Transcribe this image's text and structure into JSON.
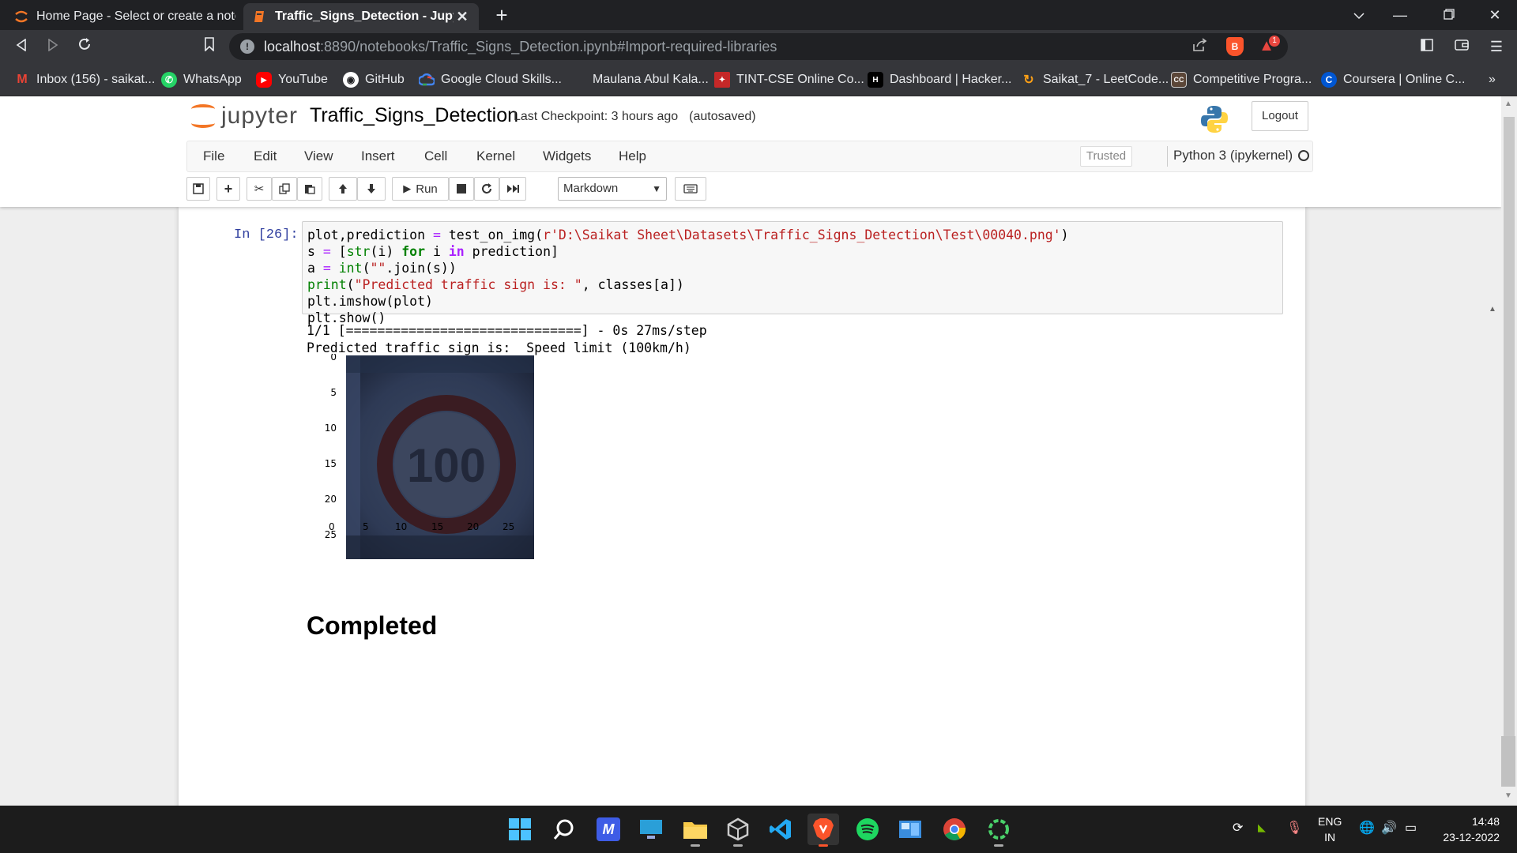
{
  "browser": {
    "tabs": [
      {
        "title": "Home Page - Select or create a notebook",
        "active": false
      },
      {
        "title": "Traffic_Signs_Detection - Jupyter Notebook",
        "active": true
      }
    ],
    "url_host": "localhost",
    "url_rest": ":8890/notebooks/Traffic_Signs_Detection.ipynb#Import-required-libraries",
    "brave_badge": "1",
    "bookmarks": [
      {
        "label": "Inbox (156) - saikat...",
        "icon": "gmail-icon",
        "color": "#ea4335"
      },
      {
        "label": "WhatsApp",
        "icon": "whatsapp-icon",
        "color": "#25d366"
      },
      {
        "label": "YouTube",
        "icon": "youtube-icon",
        "color": "#ff0000"
      },
      {
        "label": "GitHub",
        "icon": "github-icon",
        "color": "#ffffff"
      },
      {
        "label": "Google Cloud Skills...",
        "icon": "google-cloud-icon",
        "color": "#4285f4"
      },
      {
        "label": "Maulana Abul Kala...",
        "icon": "university-icon",
        "color": "#35363a"
      },
      {
        "label": "TINT-CSE Online Co...",
        "icon": "tint-icon",
        "color": "#c62828"
      },
      {
        "label": "Dashboard | Hacker...",
        "icon": "hackerrank-icon",
        "color": "#1ba94c"
      },
      {
        "label": "Saikat_7 - LeetCode...",
        "icon": "leetcode-icon",
        "color": "#ffa116"
      },
      {
        "label": "Competitive Progra...",
        "icon": "codechef-icon",
        "color": "#5b4638"
      },
      {
        "label": "Coursera | Online C...",
        "icon": "coursera-icon",
        "color": "#0056d2"
      }
    ]
  },
  "jupyter": {
    "logo_text": "jupyter",
    "notebook_name": "Traffic_Signs_Detection",
    "checkpoint": "Last Checkpoint: 3 hours ago",
    "autosaved": "(autosaved)",
    "logout_label": "Logout",
    "menus": [
      "File",
      "Edit",
      "View",
      "Insert",
      "Cell",
      "Kernel",
      "Widgets",
      "Help"
    ],
    "trusted_label": "Trusted",
    "kernel_label": "Python 3 (ipykernel)",
    "run_label": "Run",
    "cell_type": "Markdown"
  },
  "cell": {
    "prompt": "In [26]:",
    "code": {
      "l1_a": "plot,prediction ",
      "l1_eq": "=",
      "l1_b": " test_on_img(",
      "l1_str": "r'D:\\Saikat Sheet\\Datasets\\Traffic_Signs_Detection\\Test\\00040.png'",
      "l1_c": ")",
      "l2_a": "s ",
      "l2_eq": "=",
      "l2_b": " [",
      "l2_str": "str",
      "l2_c": "(i) ",
      "l2_for": "for",
      "l2_d": " i ",
      "l2_in": "in",
      "l2_e": " prediction]",
      "l3_a": "a ",
      "l3_eq": "=",
      "l3_b": " ",
      "l3_int": "int",
      "l3_c": "(",
      "l3_str": "\"\"",
      "l3_d": ".join(s))",
      "l4_print": "print",
      "l4_a": "(",
      "l4_str": "\"Predicted traffic sign is: \"",
      "l4_b": ", classes[a])",
      "l5": "plt.imshow(plot)",
      "l6": "plt.show()"
    },
    "output_lines": [
      "1/1 [==============================] - 0s 27ms/step",
      "Predicted traffic sign is:  Speed limit (100km/h)"
    ],
    "plot": {
      "y_ticks": [
        "0",
        "5",
        "10",
        "15",
        "20",
        "25"
      ],
      "x_ticks": [
        "0",
        "5",
        "10",
        "15",
        "20",
        "25"
      ],
      "sign_text": "100"
    }
  },
  "markdown_heading": "Completed",
  "taskbar": {
    "lang_top": "ENG",
    "lang_bottom": "IN",
    "time": "14:48",
    "date": "23-12-2022"
  }
}
